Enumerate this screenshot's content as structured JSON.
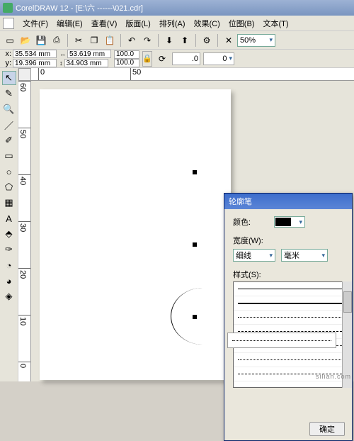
{
  "app": {
    "title": "CorelDRAW 12 - [E:\\六 ------\\021.cdr]"
  },
  "menu": {
    "items": [
      "文件(F)",
      "编辑(E)",
      "查看(V)",
      "版面(L)",
      "排列(A)",
      "效果(C)",
      "位图(B)",
      "文本(T)"
    ]
  },
  "toolbar": {
    "zoom": "50%"
  },
  "props": {
    "x_label": "x:",
    "x": "35.534 mm",
    "y_label": "y:",
    "y": "19.396 mm",
    "w": "53.619 mm",
    "h": "34.903 mm",
    "sx": "100.0",
    "sy": "100.0",
    "angle": ".0",
    "rot": "0"
  },
  "ruler_h": [
    "0",
    "50"
  ],
  "ruler_v": [
    "60",
    "50",
    "40",
    "30",
    "20",
    "10",
    "0"
  ],
  "dialog": {
    "title": "轮廓笔",
    "color_label": "颜色:",
    "width_label": "宽度(W):",
    "width_val": "细线",
    "unit_val": "毫米",
    "style_label": "样式(S):",
    "ok": "确定"
  },
  "watermark": "silian.com"
}
